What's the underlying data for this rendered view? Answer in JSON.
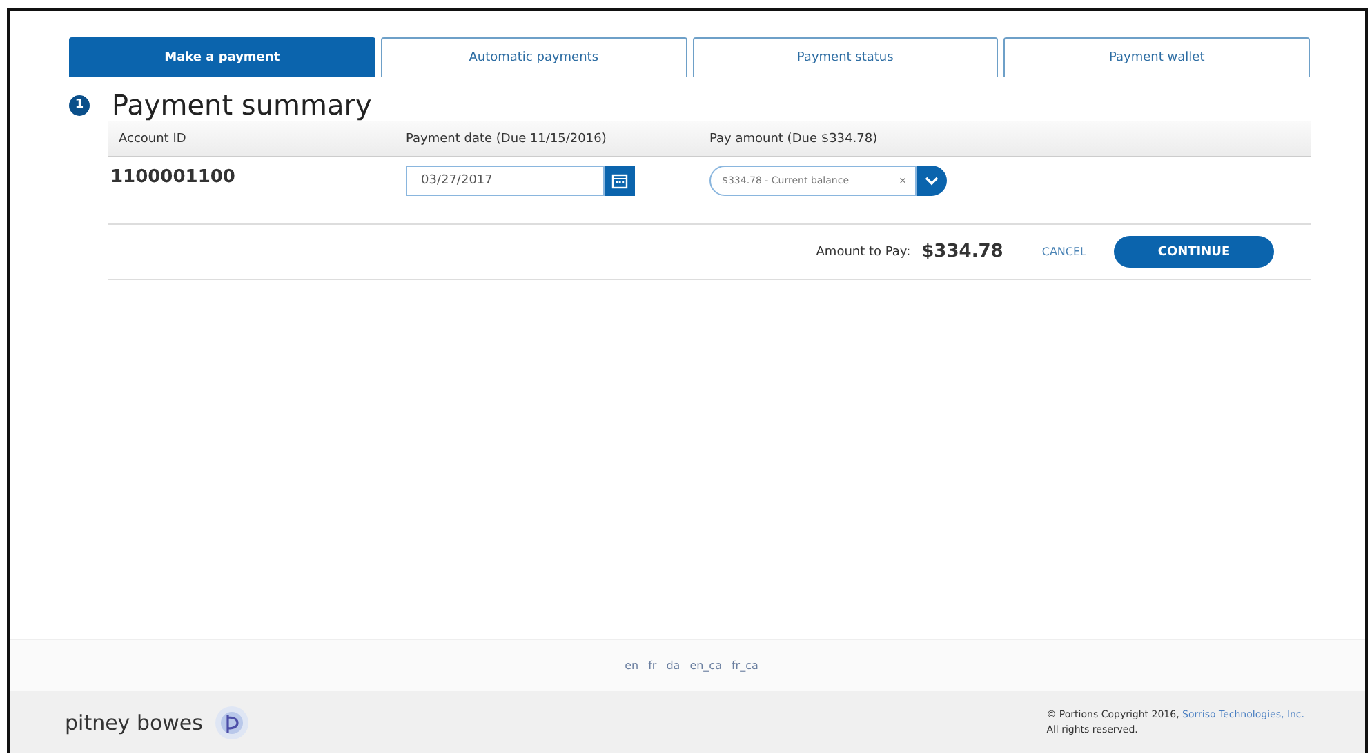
{
  "tabs": [
    {
      "label": "Make a payment",
      "selected": true
    },
    {
      "label": "Automatic payments",
      "selected": false
    },
    {
      "label": "Payment status",
      "selected": false
    },
    {
      "label": "Payment wallet",
      "selected": false
    }
  ],
  "section": {
    "step": "1",
    "title": "Payment summary"
  },
  "table": {
    "columns": [
      "Account ID",
      "Payment date (Due 11/15/2016)",
      "Pay amount (Due $334.78)"
    ],
    "row": {
      "account_id": "1100001100",
      "payment_date": "03/27/2017",
      "pay_amount": "$334.78 - Current balance",
      "clear": "×"
    }
  },
  "actions": {
    "amount_label": "Amount to Pay:",
    "amount": "$334.78",
    "cancel": "CANCEL",
    "continue": "CONTINUE"
  },
  "footer": {
    "languages": [
      "en",
      "fr",
      "da",
      "en_ca",
      "fr_ca"
    ],
    "logo": "pitney bowes",
    "copyright": "© Portions Copyright 2016, ",
    "company_link": "Sorriso Technologies, Inc.",
    "rights": "All rights reserved."
  }
}
